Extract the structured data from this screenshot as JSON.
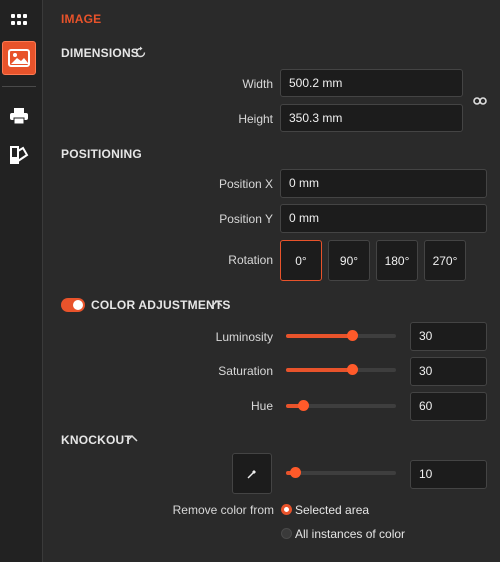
{
  "accent": "#e8532b",
  "rail": {
    "items": [
      {
        "icon": "grid-icon"
      },
      {
        "icon": "image-icon",
        "active": true
      },
      {
        "icon": "printer-icon"
      },
      {
        "icon": "color-swatch-icon"
      }
    ]
  },
  "panel": {
    "title": "IMAGE",
    "dimensions": {
      "heading": "DIMENSIONS",
      "reset_icon": "reset-icon",
      "width_label": "Width",
      "width_value": "500.2 mm",
      "height_label": "Height",
      "height_value": "350.3 mm",
      "link_icon": "link-icon"
    },
    "positioning": {
      "heading": "POSITIONING",
      "pos_x_label": "Position X",
      "pos_x_value": "0 mm",
      "pos_y_label": "Position Y",
      "pos_y_value": "0 mm",
      "rotation_label": "Rotation",
      "rotation_options": [
        "0°",
        "90°",
        "180°",
        "270°"
      ],
      "rotation_selected": "0°"
    },
    "color_adjustments": {
      "heading": "COLOR ADJUSTMENTS",
      "enabled": true,
      "sliders": [
        {
          "label": "Luminosity",
          "value": "30",
          "level": 0.6
        },
        {
          "label": "Saturation",
          "value": "30",
          "level": 0.6
        },
        {
          "label": "Hue",
          "value": "60",
          "level": 0.15
        }
      ]
    },
    "knockout": {
      "heading": "KNOCKOUT",
      "eyedropper_icon": "eyedropper-icon",
      "value": "10",
      "level": 0.08,
      "remove_label": "Remove color from",
      "options": [
        "Selected area",
        "All instances of color"
      ],
      "selected": "Selected area"
    }
  }
}
